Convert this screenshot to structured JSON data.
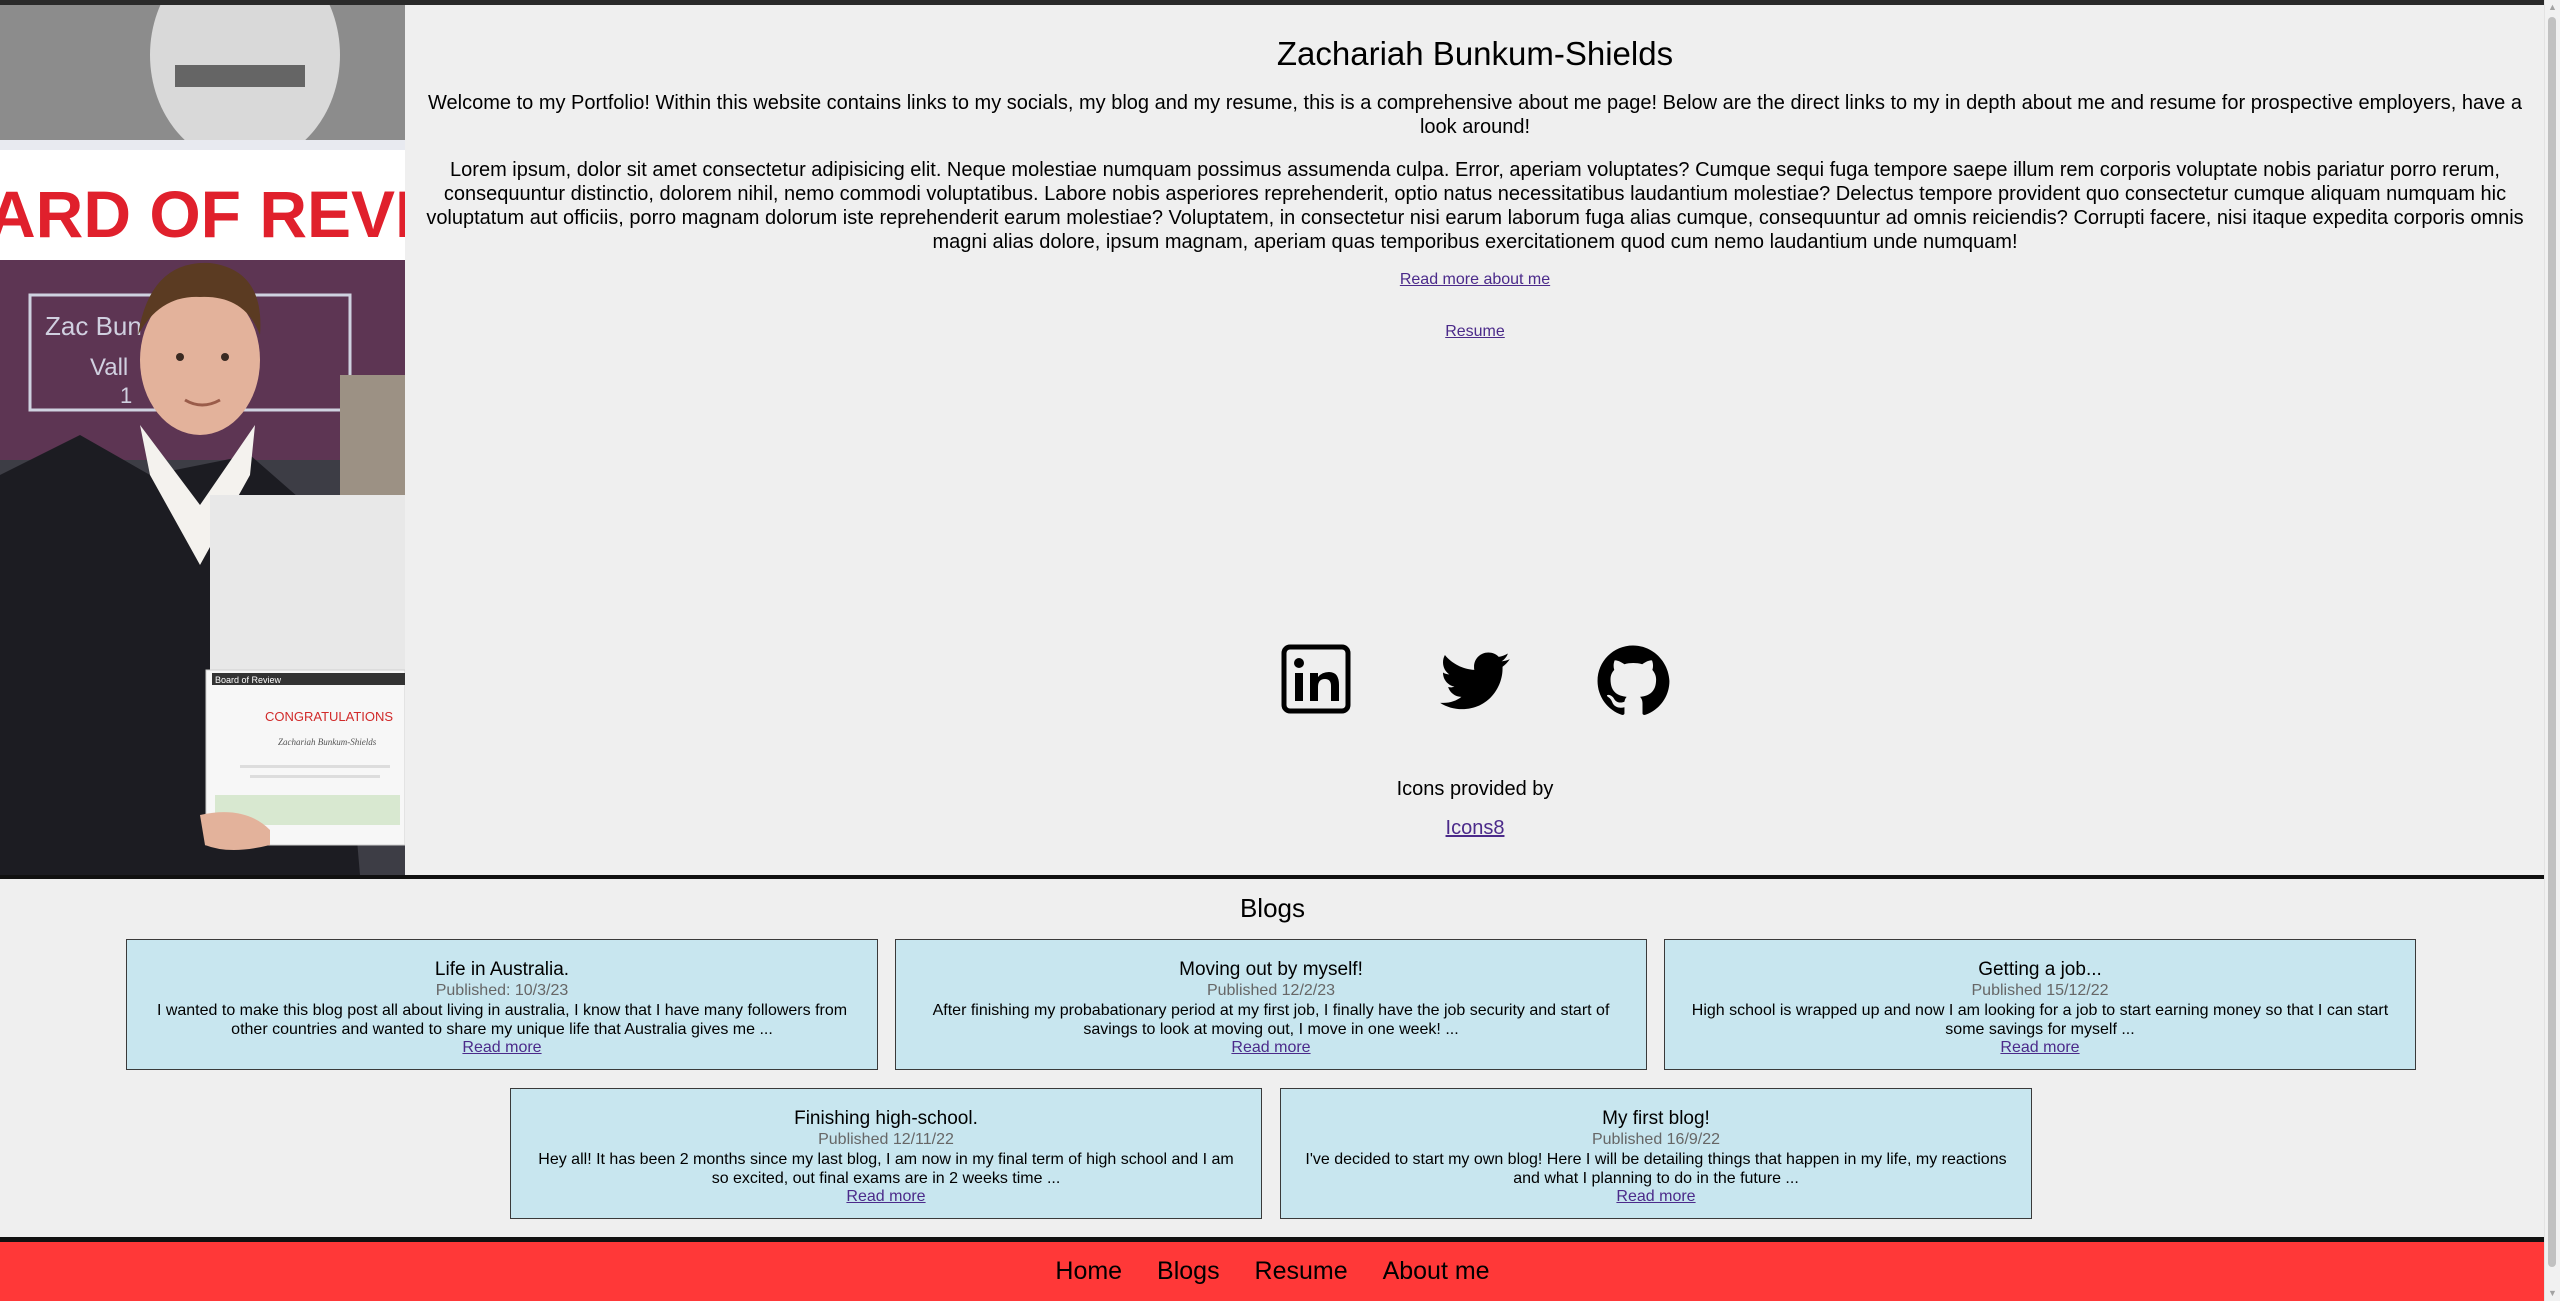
{
  "header": {
    "name": "Zachariah Bunkum-Shields",
    "welcome": "Welcome to my Portfolio! Within this website contains links to my socials, my blog and my resume, this is a comprehensive about me page! Below are the direct links to my in depth about me and resume for prospective employers, have a look around!",
    "lorem": "Lorem ipsum, dolor sit amet consectetur adipisicing elit. Neque molestiae numquam possimus assumenda culpa. Error, aperiam voluptates? Cumque sequi fuga tempore saepe illum rem corporis voluptate nobis pariatur porro rerum, consequuntur distinctio, dolorem nihil, nemo commodi voluptatibus. Labore nobis asperiores reprehenderit, optio natus necessitatibus laudantium molestiae? Delectus tempore provident quo consectetur cumque aliquam numquam hic voluptatum aut officiis, porro magnam dolorum iste reprehenderit earum molestiae? Voluptatem, in consectetur nisi earum laborum fuga alias cumque, consequuntur ad omnis reiciendis? Corrupti facere, nisi itaque expedita corporis omnis magni alias dolore, ipsum magnam, aperiam quas temporibus exercitationem quod cum nemo laudantium unde numquam!",
    "read_more_about": "Read more about me",
    "resume_link": "Resume",
    "icons_credit": "Icons provided by",
    "icons8": "Icons8"
  },
  "photo": {
    "banner_text": "ARD OF REVIEW",
    "plaque_line1": "Zac Bun",
    "plaque_line2": "Vall",
    "plaque_line3": "1",
    "cert_header": "Board of Review",
    "cert_title": "CONGRATULATIONS",
    "cert_name": "Zachariah Bunkum-Shields"
  },
  "socials": [
    {
      "name": "linkedin-icon"
    },
    {
      "name": "twitter-icon"
    },
    {
      "name": "github-icon"
    }
  ],
  "blogs": {
    "title": "Blogs",
    "read_more": "Read more",
    "items": [
      {
        "title": "Life in Australia.",
        "date": "Published: 10/3/23",
        "excerpt": "I wanted to make this blog post all about living in australia, I know that I have many followers from other countries and wanted to share my unique life that Australia gives me ..."
      },
      {
        "title": "Moving out by myself!",
        "date": "Published 12/2/23",
        "excerpt": "After finishing my probabationary period at my first job, I finally have the job security and start of savings to look at moving out, I move in one week! ..."
      },
      {
        "title": "Getting a job...",
        "date": "Published 15/12/22",
        "excerpt": "High school is wrapped up and now I am looking for a job to start earning money so that I can start some savings for myself ..."
      },
      {
        "title": "Finishing high-school.",
        "date": "Published 12/11/22",
        "excerpt": "Hey all! It has been 2 months since my last blog, I am now in my final term of high school and I am so excited, out final exams are in 2 weeks time ..."
      },
      {
        "title": "My first blog!",
        "date": "Published 16/9/22",
        "excerpt": "I've decided to start my own blog! Here I will be detailing things that happen in my life, my reactions and what I planning to do in the future ..."
      }
    ]
  },
  "footer": {
    "home": "Home",
    "blogs": "Blogs",
    "resume": "Resume",
    "about": "About me"
  },
  "colors": {
    "footer_bg": "#ff3838",
    "card_bg": "#c8e6ef",
    "link": "#4b2a8a"
  }
}
